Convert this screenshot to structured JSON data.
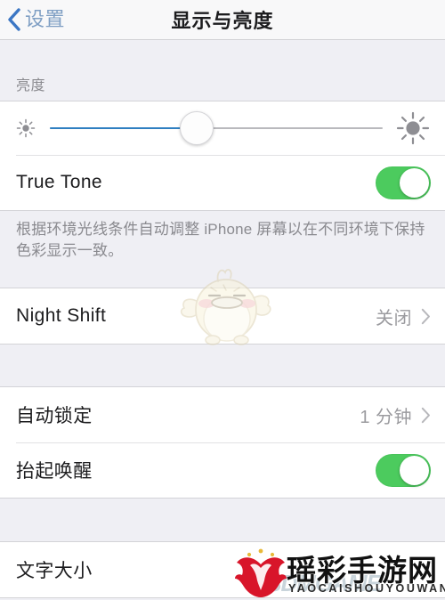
{
  "navbar": {
    "back_label": "设置",
    "back_icon": "chevron-left-icon",
    "title": "显示与亮度"
  },
  "brightness_section": {
    "header": "亮度",
    "slider": {
      "name": "brightness-slider",
      "value_percent": 44,
      "min_icon": "sun-small-icon",
      "max_icon": "sun-large-icon"
    },
    "true_tone": {
      "label": "True Tone",
      "toggle_state": "on",
      "toggle_color": "#4ccb5e"
    },
    "footer_note": "根据环境光线条件自动调整 iPhone 屏幕以在不同环境下保持色彩显示一致。"
  },
  "night_shift_section": {
    "row": {
      "label": "Night Shift",
      "value": "关闭",
      "accessory_icon": "chevron-right-icon"
    }
  },
  "lock_section": {
    "auto_lock": {
      "label": "自动锁定",
      "value": "1 分钟",
      "accessory_icon": "chevron-right-icon"
    },
    "raise_to_wake": {
      "label": "抬起唤醒",
      "toggle_state": "on",
      "toggle_color": "#4ccb5e"
    }
  },
  "text_section": {
    "text_size": {
      "label": "文字大小"
    }
  },
  "watermarks": {
    "mascot_icon": "chick-mascot-watermark",
    "site_name_cn": "瑶彩手游网",
    "site_name_pinyin": "YAOCAISHOUYOUWANG",
    "overlay_text": "3DMGAME",
    "emblem_icon": "phoenix-emblem-icon",
    "emblem_color": "#d8152a"
  }
}
